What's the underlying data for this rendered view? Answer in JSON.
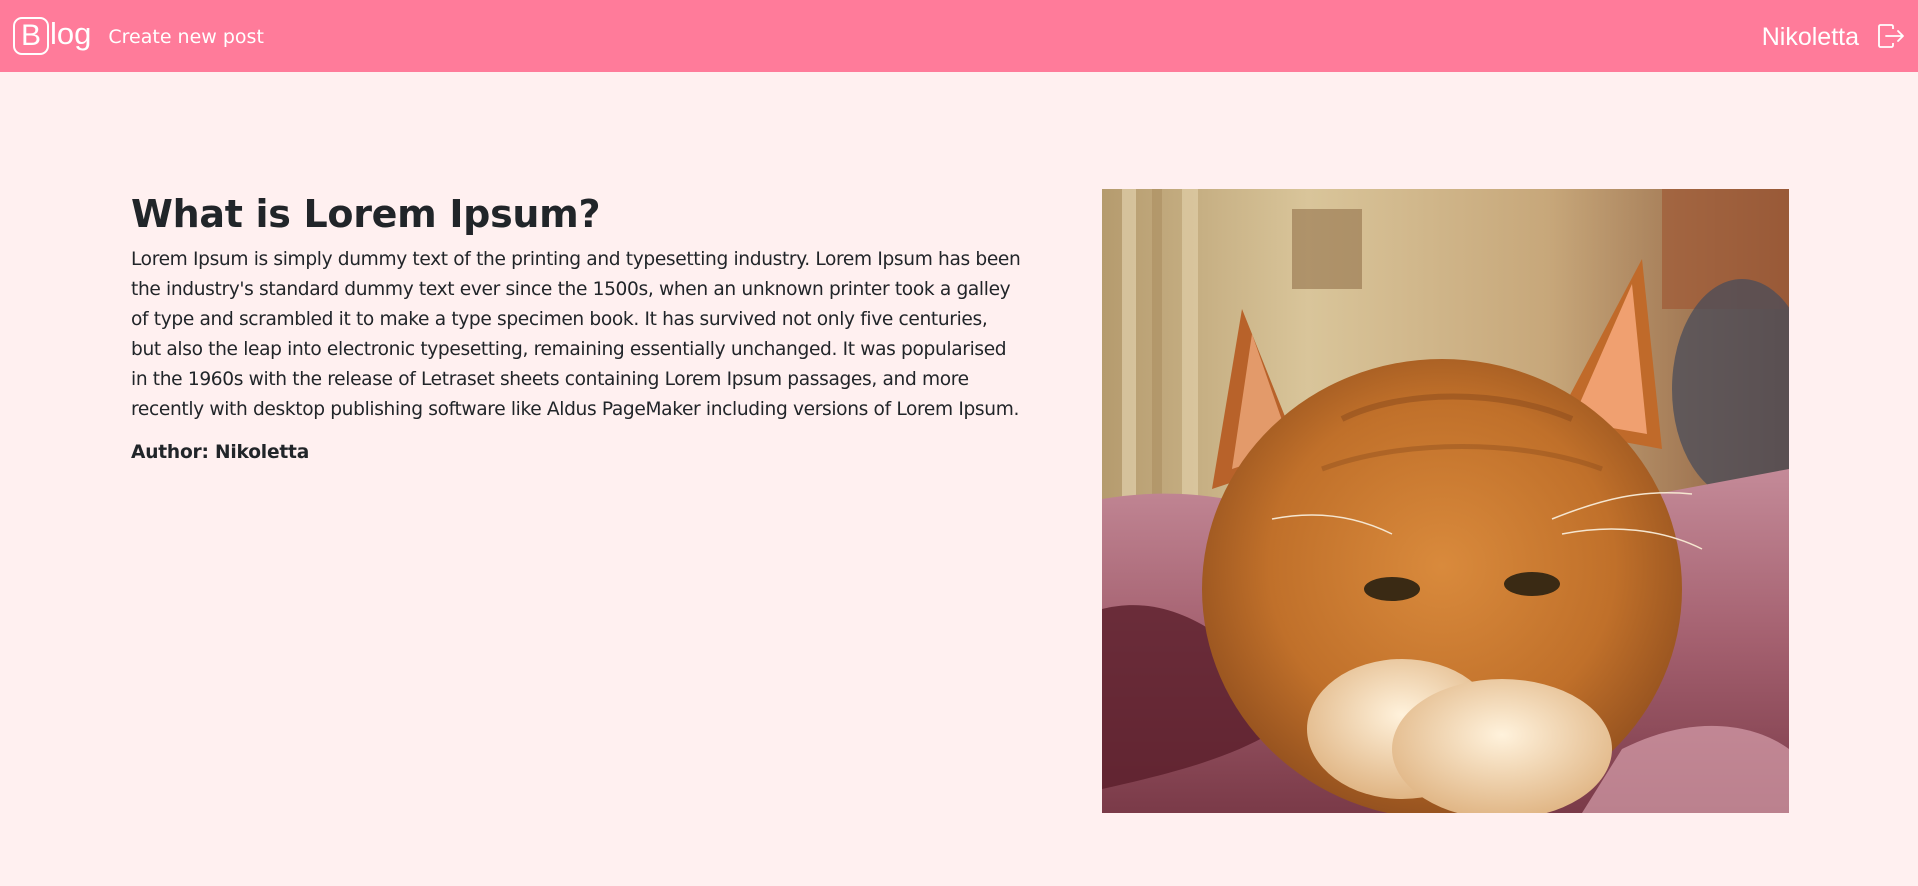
{
  "navbar": {
    "brand_letter": "B",
    "brand_rest": "log",
    "create_link": "Create new post",
    "username": "Nikoletta",
    "logout_icon": "box-arrow-right-icon"
  },
  "post": {
    "title": "What is Lorem Ipsum?",
    "body": "Lorem Ipsum is simply dummy text of the printing and typesetting industry. Lorem Ipsum has been the industry's standard dummy text ever since the 1500s, when an unknown printer took a galley of type and scrambled it to make a type specimen book. It has survived not only five centuries, but also the leap into electronic typesetting, remaining essentially unchanged. It was popularised in the 1960s with the release of Letraset sheets containing Lorem Ipsum passages, and more recently with desktop publishing software like Aldus PageMaker including versions of Lorem Ipsum.",
    "author": "Author: Nikoletta",
    "image_subject": "orange-tabby-cat-on-bed"
  },
  "colors": {
    "navbar_bg": "#ff7b9a",
    "page_bg": "#fff0f0",
    "text": "#212529",
    "nav_text": "#ffffff"
  }
}
